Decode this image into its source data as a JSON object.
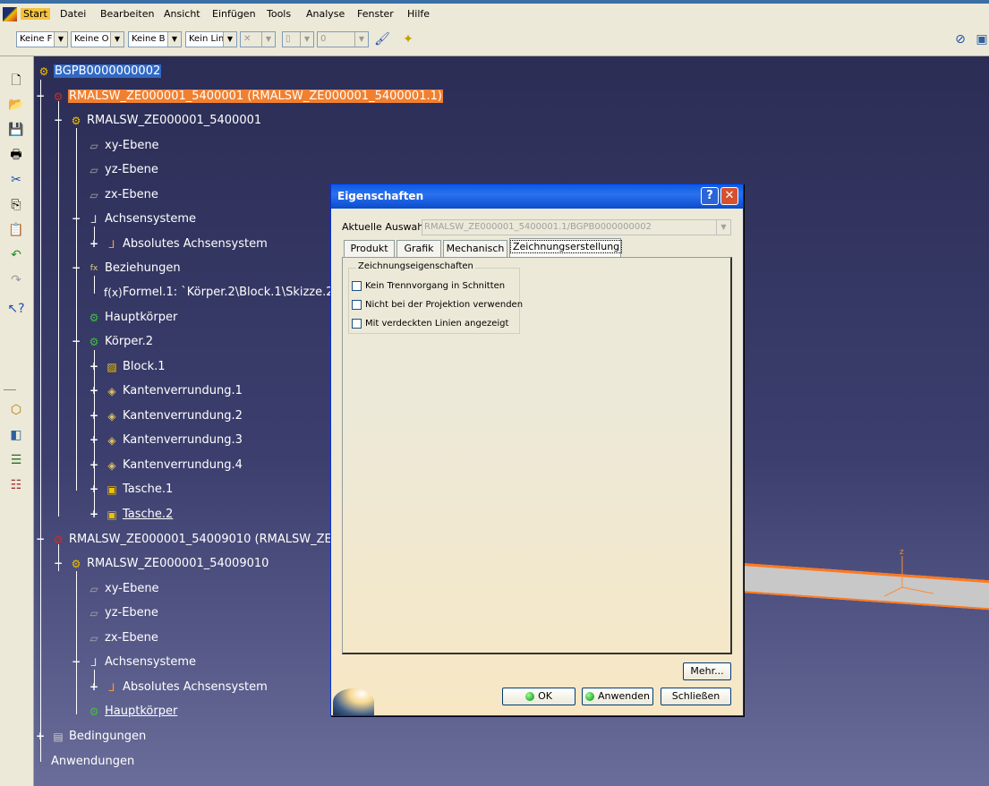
{
  "menubar": {
    "items": [
      "Start",
      "Datei",
      "Bearbeiten",
      "Ansicht",
      "Einfügen",
      "Tools",
      "Analyse",
      "Fenster",
      "Hilfe"
    ]
  },
  "toolbar": {
    "combos": [
      "Keine F",
      "Keine O",
      "Keine B",
      "Kein Lin"
    ],
    "linewidth_value": "0"
  },
  "tree": {
    "root": "BGPB0000000002",
    "product1": "RMALSW_ZE000001_5400001 (RMALSW_ZE000001_5400001.1)",
    "part1": "RMALSW_ZE000001_5400001",
    "xy": "xy-Ebene",
    "yz": "yz-Ebene",
    "zx": "zx-Ebene",
    "achsensysteme": "Achsensysteme",
    "absolut": "Absolutes Achsensystem",
    "beziehungen": "Beziehungen",
    "formel": "Formel.1: `Körper.2\\Block.1\\Skizze.2`",
    "hauptkoerper": "Hauptkörper",
    "koerper2": "Körper.2",
    "block1": "Block.1",
    "kv1": "Kantenverrundung.1",
    "kv2": "Kantenverrundung.2",
    "kv3": "Kantenverrundung.3",
    "kv4": "Kantenverrundung.4",
    "tasche1": "Tasche.1",
    "tasche2": "Tasche.2",
    "product2": "RMALSW_ZE000001_54009010 (RMALSW_ZE",
    "part2": "RMALSW_ZE000001_54009010",
    "bedingungen": "Bedingungen",
    "anwendungen": "Anwendungen"
  },
  "dialog": {
    "title": "Eigenschaften",
    "aktuelle_label": "Aktuelle Auswahl:",
    "aktuelle_value": "RMALSW_ZE000001_5400001.1/BGPB0000000002",
    "tabs": [
      "Produkt",
      "Grafik",
      "Mechanisch",
      "Zeichnungserstellung"
    ],
    "group_title": "Zeichnungseigenschaften",
    "checkboxes": [
      "Kein Trennvorgang in Schnitten",
      "Nicht bei der Projektion verwenden",
      "Mit verdeckten Linien angezeigt"
    ],
    "more": "Mehr...",
    "ok": "OK",
    "apply": "Anwenden",
    "close": "Schließen"
  }
}
